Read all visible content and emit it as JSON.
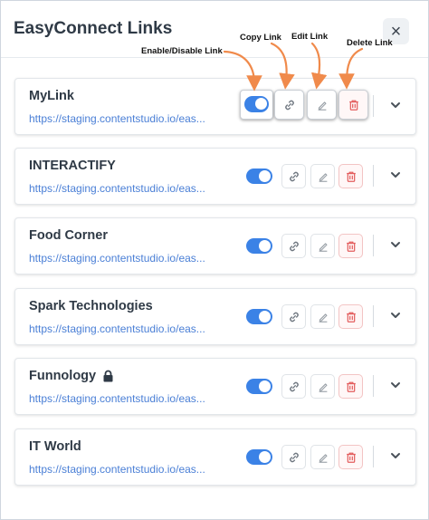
{
  "modal": {
    "title": "EasyConnect Links",
    "close_glyph": "×"
  },
  "annotations": {
    "toggle": "Enable/Disable Link",
    "copy": "Copy Link",
    "edit": "Edit Link",
    "delete": "Delete Link",
    "arrow_color": "#f08a4b"
  },
  "links": [
    {
      "name": "MyLink",
      "url": "https://staging.contentstudio.io/eas...",
      "enabled": true,
      "locked": false
    },
    {
      "name": "INTERACTIFY",
      "url": "https://staging.contentstudio.io/eas...",
      "enabled": true,
      "locked": false
    },
    {
      "name": "Food Corner",
      "url": "https://staging.contentstudio.io/eas...",
      "enabled": true,
      "locked": false
    },
    {
      "name": "Spark Technologies",
      "url": "https://staging.contentstudio.io/eas...",
      "enabled": true,
      "locked": false
    },
    {
      "name": "Funnology",
      "url": "https://staging.contentstudio.io/eas...",
      "enabled": true,
      "locked": true
    },
    {
      "name": "IT World",
      "url": "https://staging.contentstudio.io/eas...",
      "enabled": true,
      "locked": false
    }
  ],
  "icons": {
    "copy": "link-icon",
    "edit": "pencil-icon",
    "delete": "trash-icon",
    "expand": "chevron-down-icon",
    "lock": "lock-icon"
  },
  "colors": {
    "accent": "#3b82e6",
    "url": "#4a7fd6",
    "delete": "#e35d5d"
  }
}
